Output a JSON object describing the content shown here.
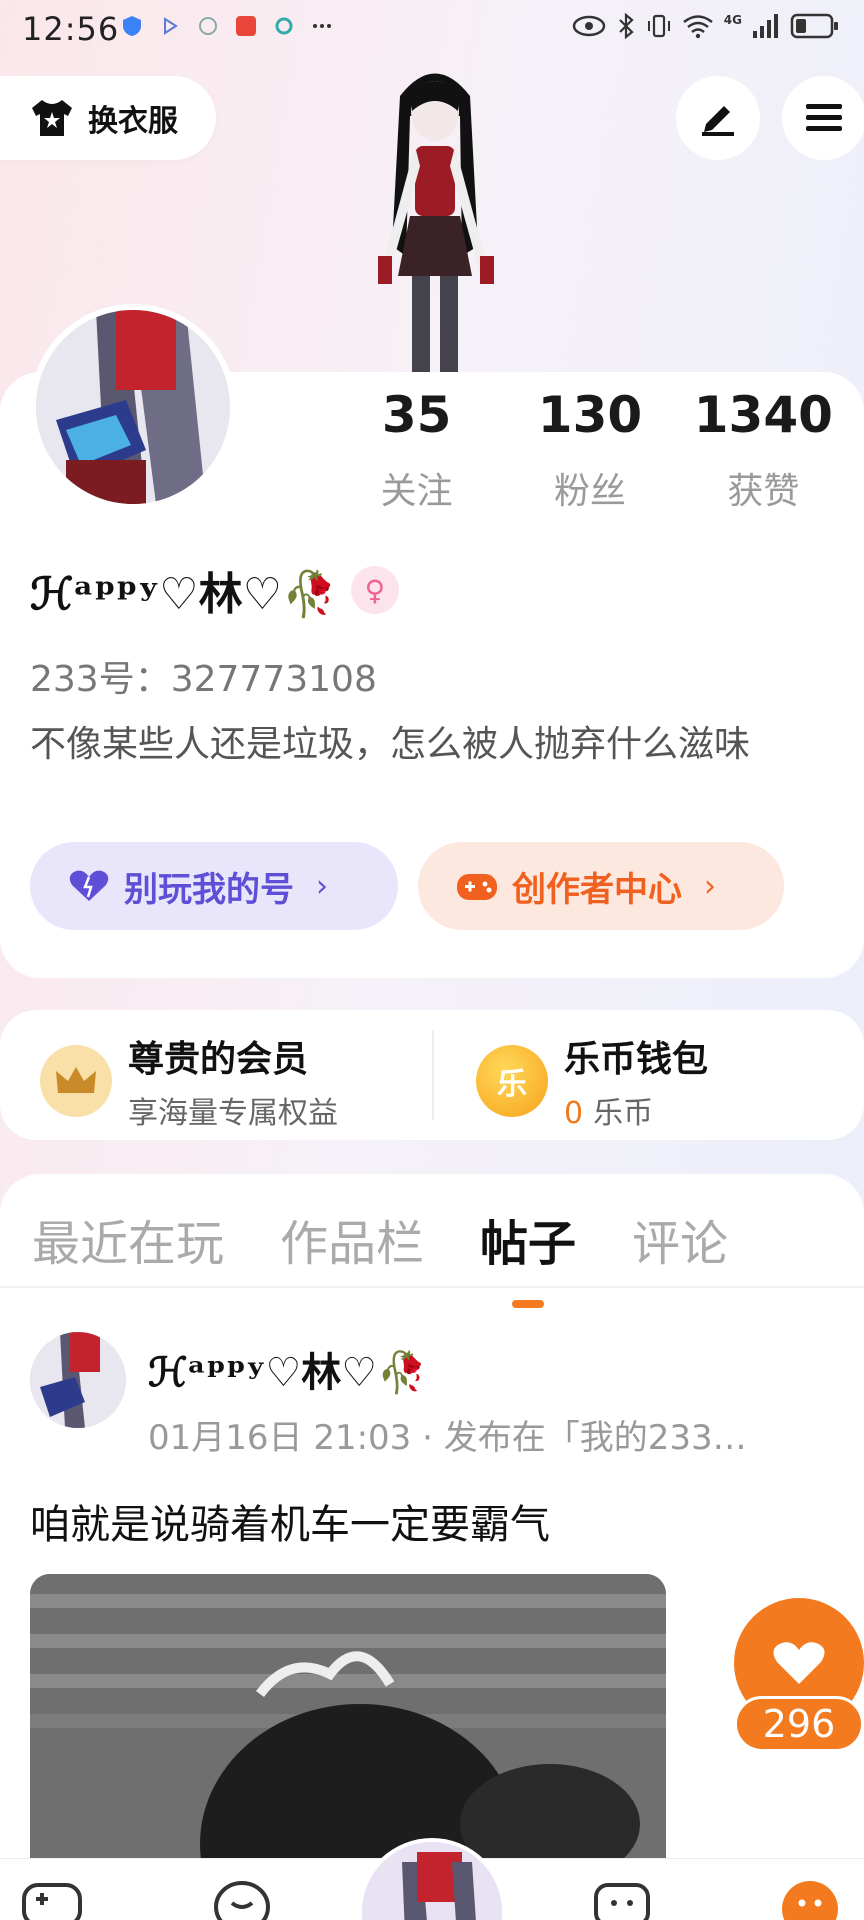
{
  "status_bar": {
    "time": "12:56",
    "network": "4G"
  },
  "top": {
    "wardrobe_label": "换衣服",
    "edit_icon": "pen-icon",
    "menu_icon": "menu-icon"
  },
  "profile": {
    "stats": [
      {
        "value": "35",
        "label": "关注"
      },
      {
        "value": "130",
        "label": "粉丝"
      },
      {
        "value": "1340",
        "label": "获赞"
      }
    ],
    "name": "ℋᵃᵖᵖʸ♡林♡🥀",
    "gender_symbol": "♀",
    "uid": "233号：327773108",
    "bio": "不像某些人还是垃圾，怎么被人抛弃什么滋味",
    "buttons": {
      "protect": "别玩我的号",
      "creator": "创作者中心",
      "chevron": "›"
    }
  },
  "wallet": {
    "member_title": "尊贵的会员",
    "member_sub": "享海量专属权益",
    "coin_title": "乐币钱包",
    "coin_amount": "0",
    "coin_unit": "乐币",
    "coin_icon_text": "乐"
  },
  "tabs": [
    "最近在玩",
    "作品栏",
    "帖子",
    "评论"
  ],
  "active_tab": "帖子",
  "post": {
    "author": "ℋᵃᵖᵖʸ♡林♡🥀",
    "meta": "01月16日 21:03 · 发布在「我的233…",
    "text": "咱就是说骑着机车一定要霸气",
    "likes": "296"
  },
  "colors": {
    "accent": "#f47a20",
    "purple": "#5f4fd6"
  }
}
